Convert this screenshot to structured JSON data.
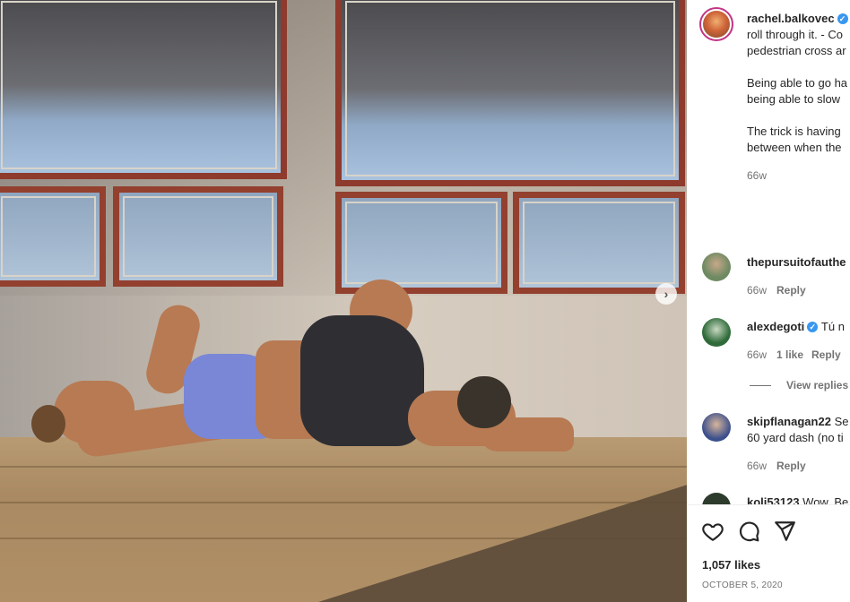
{
  "post": {
    "author": "rachel.balkovec",
    "caption_lines": [
      "roll through it. - Co",
      "pedestrian cross ar",
      "",
      "Being able to go ha",
      "being able to slow",
      "",
      "The trick is having",
      "between when the"
    ],
    "time": "66w",
    "likes": "1,057 likes",
    "date": "OCTOBER 5, 2020"
  },
  "comments": [
    {
      "user": "thepursuitofauthe",
      "text": "",
      "time": "66w",
      "likes": "",
      "reply": "Reply",
      "verified": false,
      "avatar_color": "#6e8a62"
    },
    {
      "user": "alexdegoti",
      "text": "Tú n",
      "time": "66w",
      "likes": "1 like",
      "reply": "Reply",
      "verified": true,
      "view_replies": "View replies (",
      "avatar_color": "#2f6b3a"
    },
    {
      "user": "skipflanagan22",
      "text": "Se",
      "text2": "60 yard dash (no ti",
      "time": "66w",
      "likes": "",
      "reply": "Reply",
      "verified": false,
      "avatar_color": "#3b4f8c"
    },
    {
      "user": "koli53123",
      "text": "Wow. Be",
      "verified": false,
      "avatar_color": "#2d3b2c"
    }
  ],
  "icons": {
    "like": "heart-icon",
    "comment": "comment-icon",
    "share": "send-icon",
    "verified": "verified-badge-icon",
    "next": "chevron-right-icon"
  },
  "colors": {
    "verified": "#3897f0",
    "text": "#262626",
    "muted": "#737373",
    "frame": "#8e3a2c"
  }
}
